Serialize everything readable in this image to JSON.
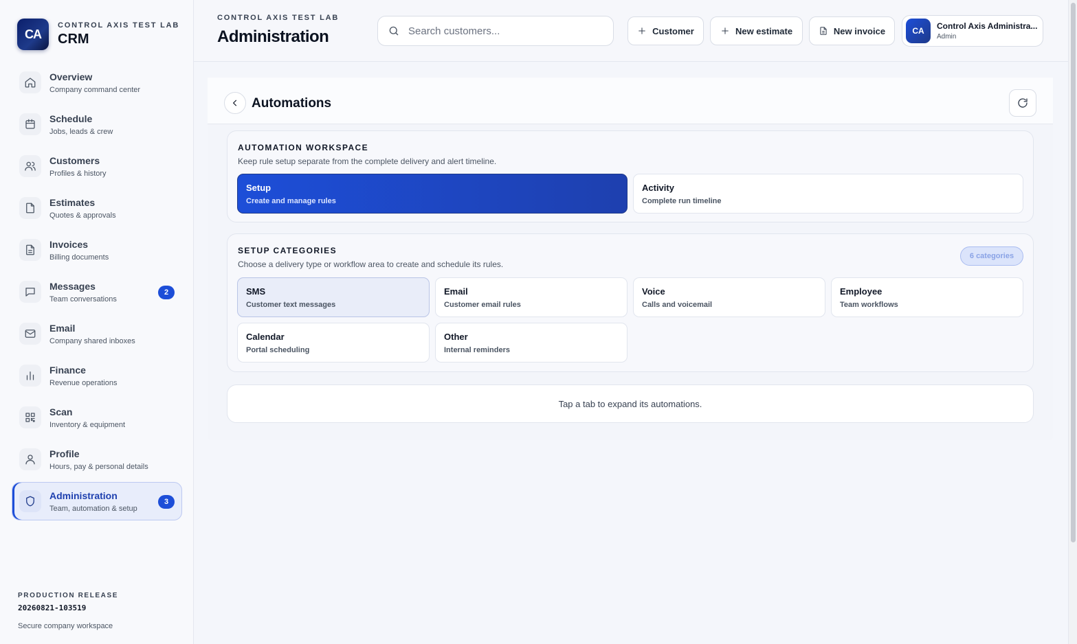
{
  "brand": {
    "logo_text": "CA",
    "org": "CONTROL AXIS TEST LAB",
    "app": "CRM"
  },
  "nav": [
    {
      "label": "Overview",
      "sub": "Company command center",
      "icon": "home-icon"
    },
    {
      "label": "Schedule",
      "sub": "Jobs, leads & crew",
      "icon": "calendar-icon"
    },
    {
      "label": "Customers",
      "sub": "Profiles & history",
      "icon": "users-icon"
    },
    {
      "label": "Estimates",
      "sub": "Quotes & approvals",
      "icon": "file-icon"
    },
    {
      "label": "Invoices",
      "sub": "Billing documents",
      "icon": "document-icon"
    },
    {
      "label": "Messages",
      "sub": "Team conversations",
      "icon": "chat-icon",
      "badge": "2"
    },
    {
      "label": "Email",
      "sub": "Company shared inboxes",
      "icon": "mail-icon"
    },
    {
      "label": "Finance",
      "sub": "Revenue operations",
      "icon": "bar-chart-icon"
    },
    {
      "label": "Scan",
      "sub": "Inventory & equipment",
      "icon": "qr-icon"
    },
    {
      "label": "Profile",
      "sub": "Hours, pay & personal details",
      "icon": "user-icon"
    },
    {
      "label": "Administration",
      "sub": "Team, automation & setup",
      "icon": "shield-icon",
      "badge": "3",
      "active": true
    }
  ],
  "release": {
    "label": "PRODUCTION RELEASE",
    "version": "20260821-103519",
    "note": "Secure company workspace"
  },
  "topbar": {
    "org": "CONTROL AXIS TEST LAB",
    "title": "Administration",
    "search_placeholder": "Search customers...",
    "buttons": {
      "customer": "Customer",
      "estimate": "New estimate",
      "invoice": "New invoice"
    },
    "user": {
      "initials": "CA",
      "name": "Control Axis Administra...",
      "role": "Admin"
    }
  },
  "automations": {
    "title": "Automations",
    "workspace": {
      "title": "AUTOMATION WORKSPACE",
      "desc": "Keep rule setup separate from the complete delivery and alert timeline.",
      "tabs": [
        {
          "label": "Setup",
          "sub": "Create and manage rules"
        },
        {
          "label": "Activity",
          "sub": "Complete run timeline"
        }
      ]
    },
    "categories": {
      "title": "SETUP CATEGORIES",
      "desc": "Choose a delivery type or workflow area to create and schedule its rules.",
      "count": "6 categories",
      "items": [
        {
          "label": "SMS",
          "sub": "Customer text messages"
        },
        {
          "label": "Email",
          "sub": "Customer email rules"
        },
        {
          "label": "Voice",
          "sub": "Calls and voicemail"
        },
        {
          "label": "Employee",
          "sub": "Team workflows"
        },
        {
          "label": "Calendar",
          "sub": "Portal scheduling"
        },
        {
          "label": "Other",
          "sub": "Internal reminders"
        }
      ]
    },
    "hint": "Tap a tab to expand its automations."
  },
  "colors": {
    "accent": "#1d4ed8",
    "accent_dark": "#1e3a8a"
  }
}
